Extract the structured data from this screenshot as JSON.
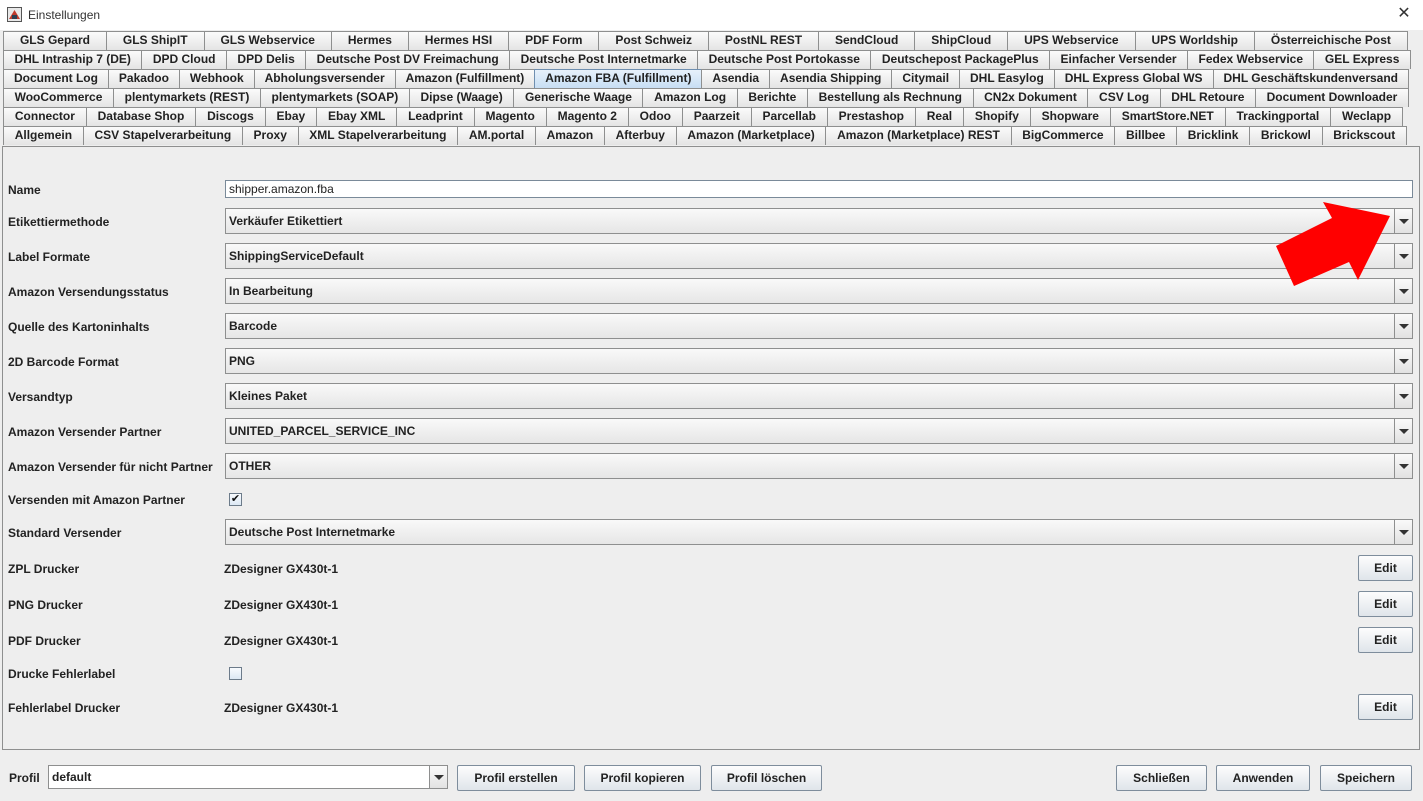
{
  "window": {
    "title": "Einstellungen",
    "close_glyph": "✕"
  },
  "tabs": {
    "rows": [
      [
        "GLS Gepard",
        "GLS ShipIT",
        "GLS Webservice",
        "Hermes",
        "Hermes HSI",
        "PDF Form",
        "Post Schweiz",
        "PostNL REST",
        "SendCloud",
        "ShipCloud",
        "UPS Webservice",
        "UPS Worldship",
        "Österreichische Post"
      ],
      [
        "DHL Intraship 7 (DE)",
        "DPD Cloud",
        "DPD Delis",
        "Deutsche Post DV Freimachung",
        "Deutsche Post Internetmarke",
        "Deutsche Post Portokasse",
        "Deutschepost PackagePlus",
        "Einfacher Versender",
        "Fedex Webservice",
        "GEL Express"
      ],
      [
        "Document Log",
        "Pakadoo",
        "Webhook",
        "Abholungsversender",
        "Amazon (Fulfillment)",
        "Amazon FBA (Fulfillment)",
        "Asendia",
        "Asendia Shipping",
        "Citymail",
        "DHL Easylog",
        "DHL Express Global WS",
        "DHL Geschäftskundenversand"
      ],
      [
        "WooCommerce",
        "plentymarkets (REST)",
        "plentymarkets (SOAP)",
        "Dipse (Waage)",
        "Generische Waage",
        "Amazon Log",
        "Berichte",
        "Bestellung als Rechnung",
        "CN2x Dokument",
        "CSV Log",
        "DHL Retoure",
        "Document Downloader"
      ],
      [
        "Connector",
        "Database Shop",
        "Discogs",
        "Ebay",
        "Ebay XML",
        "Leadprint",
        "Magento",
        "Magento 2",
        "Odoo",
        "Paarzeit",
        "Parcellab",
        "Prestashop",
        "Real",
        "Shopify",
        "Shopware",
        "SmartStore.NET",
        "Trackingportal",
        "Weclapp"
      ],
      [
        "Allgemein",
        "CSV Stapelverarbeitung",
        "Proxy",
        "XML Stapelverarbeitung",
        "AM.portal",
        "Amazon",
        "Afterbuy",
        "Amazon (Marketplace)",
        "Amazon (Marketplace) REST",
        "BigCommerce",
        "Billbee",
        "Bricklink",
        "Brickowl",
        "Brickscout"
      ]
    ],
    "active": "Amazon FBA (Fulfillment)"
  },
  "form": {
    "name": {
      "label": "Name",
      "value": "shipper.amazon.fba"
    },
    "etikettiermethode": {
      "label": "Etikettiermethode",
      "value": "Verkäufer Etikettiert"
    },
    "label_formate": {
      "label": "Label Formate",
      "value": "ShippingServiceDefault"
    },
    "versandstatus": {
      "label": "Amazon Versendungsstatus",
      "value": "In Bearbeitung"
    },
    "quelle": {
      "label": "Quelle des Kartoninhalts",
      "value": "Barcode"
    },
    "barcode_format": {
      "label": "2D Barcode Format",
      "value": "PNG"
    },
    "versandtyp": {
      "label": "Versandtyp",
      "value": "Kleines Paket"
    },
    "versender_partner": {
      "label": "Amazon Versender Partner",
      "value": "UNITED_PARCEL_SERVICE_INC"
    },
    "versender_nicht_partner": {
      "label": "Amazon Versender für nicht Partner",
      "value": "OTHER"
    },
    "versenden_partner": {
      "label": "Versenden mit Amazon Partner",
      "checked": true,
      "check_glyph": "✔"
    },
    "standard_versender": {
      "label": "Standard Versender",
      "value": "Deutsche Post Internetmarke"
    },
    "zpl_drucker": {
      "label": "ZPL Drucker",
      "value": "ZDesigner GX430t-1",
      "button": "Edit"
    },
    "png_drucker": {
      "label": "PNG Drucker",
      "value": "ZDesigner GX430t-1",
      "button": "Edit"
    },
    "pdf_drucker": {
      "label": "PDF Drucker",
      "value": "ZDesigner GX430t-1",
      "button": "Edit"
    },
    "drucke_fehlerlabel": {
      "label": "Drucke Fehlerlabel",
      "checked": false
    },
    "fehlerlabel_drucker": {
      "label": "Fehlerlabel Drucker",
      "value": "ZDesigner GX430t-1",
      "button": "Edit"
    }
  },
  "footer": {
    "profil_label": "Profil",
    "profil_value": "default",
    "buttons": {
      "erstellen": "Profil erstellen",
      "kopieren": "Profil kopieren",
      "loeschen": "Profil löschen",
      "schliessen": "Schließen",
      "anwenden": "Anwenden",
      "speichern": "Speichern"
    }
  },
  "annotation": {
    "arrow_color": "#ff0000"
  },
  "icons": [
    "app-icon",
    "close-icon",
    "chevron-down-icon",
    "checkmark-icon",
    "red-arrow-annotation"
  ]
}
